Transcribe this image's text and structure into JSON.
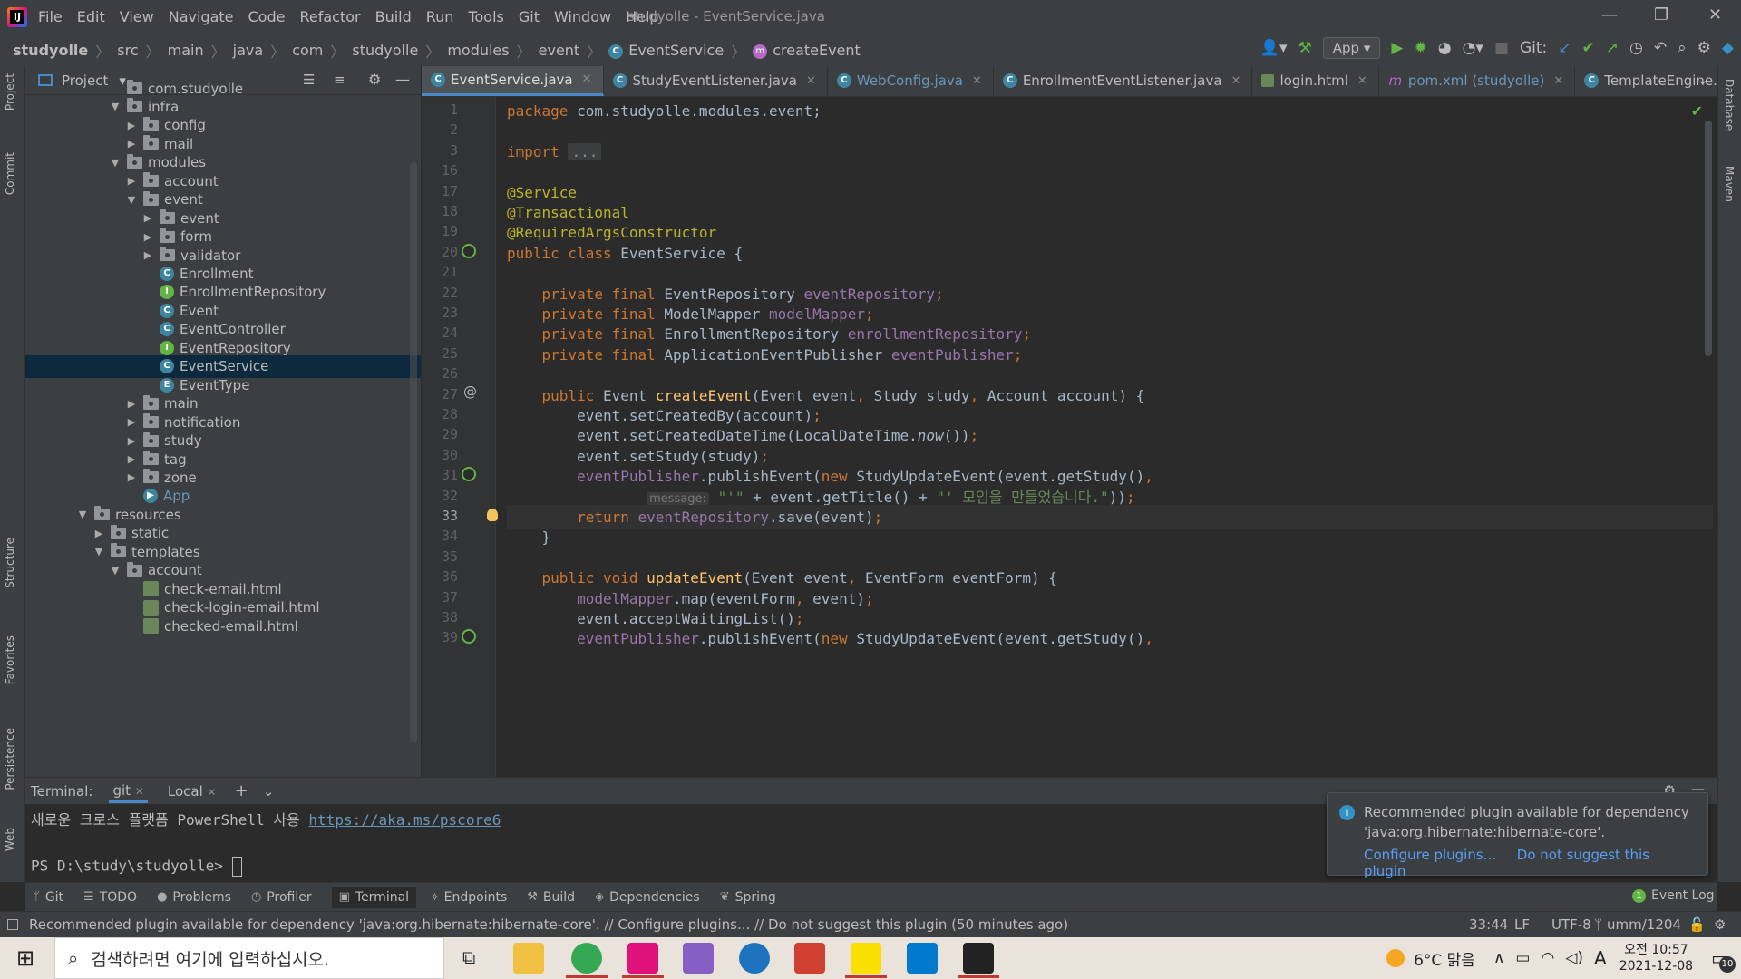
{
  "window": {
    "title": "studyolle - EventService.java"
  },
  "menu": [
    "File",
    "Edit",
    "View",
    "Navigate",
    "Code",
    "Refactor",
    "Build",
    "Run",
    "Tools",
    "Git",
    "Window",
    "Help"
  ],
  "breadcrumb": [
    "studyolle",
    "src",
    "main",
    "java",
    "com",
    "studyolle",
    "modules",
    "event",
    "EventService",
    "createEvent"
  ],
  "toolbar": {
    "run_config": "App",
    "git_label": "Git:"
  },
  "project": {
    "title": "Project",
    "tree": [
      {
        "label": "com.studyolle",
        "indent": 5,
        "arrow": "",
        "icon": "folder"
      },
      {
        "label": "infra",
        "indent": 5,
        "arrow": "open",
        "icon": "folder"
      },
      {
        "label": "config",
        "indent": 6,
        "arrow": "closed",
        "icon": "folder"
      },
      {
        "label": "mail",
        "indent": 6,
        "arrow": "closed",
        "icon": "folder"
      },
      {
        "label": "modules",
        "indent": 5,
        "arrow": "open",
        "icon": "folder"
      },
      {
        "label": "account",
        "indent": 6,
        "arrow": "closed",
        "icon": "folder"
      },
      {
        "label": "event",
        "indent": 6,
        "arrow": "open",
        "icon": "folder"
      },
      {
        "label": "event",
        "indent": 7,
        "arrow": "closed",
        "icon": "folder"
      },
      {
        "label": "form",
        "indent": 7,
        "arrow": "closed",
        "icon": "folder"
      },
      {
        "label": "validator",
        "indent": 7,
        "arrow": "closed",
        "icon": "folder"
      },
      {
        "label": "Enrollment",
        "indent": 7,
        "arrow": "",
        "icon": "class"
      },
      {
        "label": "EnrollmentRepository",
        "indent": 7,
        "arrow": "",
        "icon": "interface"
      },
      {
        "label": "Event",
        "indent": 7,
        "arrow": "",
        "icon": "class"
      },
      {
        "label": "EventController",
        "indent": 7,
        "arrow": "",
        "icon": "class"
      },
      {
        "label": "EventRepository",
        "indent": 7,
        "arrow": "",
        "icon": "interface"
      },
      {
        "label": "EventService",
        "indent": 7,
        "arrow": "",
        "icon": "class",
        "selected": true
      },
      {
        "label": "EventType",
        "indent": 7,
        "arrow": "",
        "icon": "enum"
      },
      {
        "label": "main",
        "indent": 6,
        "arrow": "closed",
        "icon": "folder"
      },
      {
        "label": "notification",
        "indent": 6,
        "arrow": "closed",
        "icon": "folder"
      },
      {
        "label": "study",
        "indent": 6,
        "arrow": "closed",
        "icon": "folder"
      },
      {
        "label": "tag",
        "indent": 6,
        "arrow": "closed",
        "icon": "folder"
      },
      {
        "label": "zone",
        "indent": 6,
        "arrow": "closed",
        "icon": "folder"
      },
      {
        "label": "App",
        "indent": 6,
        "arrow": "",
        "icon": "app"
      },
      {
        "label": "resources",
        "indent": 3,
        "arrow": "open",
        "icon": "folder"
      },
      {
        "label": "static",
        "indent": 4,
        "arrow": "closed",
        "icon": "folder"
      },
      {
        "label": "templates",
        "indent": 4,
        "arrow": "open",
        "icon": "folder"
      },
      {
        "label": "account",
        "indent": 5,
        "arrow": "open",
        "icon": "folder"
      },
      {
        "label": "check-email.html",
        "indent": 6,
        "arrow": "",
        "icon": "html"
      },
      {
        "label": "check-login-email.html",
        "indent": 6,
        "arrow": "",
        "icon": "html"
      },
      {
        "label": "checked-email.html",
        "indent": 6,
        "arrow": "",
        "icon": "html"
      }
    ]
  },
  "tabs": [
    {
      "label": "EventService.java",
      "badge": "C",
      "active": true
    },
    {
      "label": "StudyEventListener.java",
      "badge": "C"
    },
    {
      "label": "WebConfig.java",
      "badge": "C",
      "link": true
    },
    {
      "label": "EnrollmentEventListener.java",
      "badge": "C"
    },
    {
      "label": "login.html",
      "badge": "H"
    },
    {
      "label": "pom.xml (studyolle)",
      "badge": "m",
      "link": true
    },
    {
      "label": "TemplateEngine.class",
      "badge": "C"
    }
  ],
  "code": [
    {
      "n": "1",
      "html": "<span class='kw'>package</span> com.studyolle.modules.event;"
    },
    {
      "n": "2",
      "html": ""
    },
    {
      "n": "3",
      "html": "<span class='kw'>import</span> <span class='fold'>...</span>"
    },
    {
      "n": "16",
      "html": ""
    },
    {
      "n": "17",
      "html": "<span class='an'>@Service</span>"
    },
    {
      "n": "18",
      "html": "<span class='an'>@Transactional</span>"
    },
    {
      "n": "19",
      "html": "<span class='an'>@RequiredArgsConstructor</span>"
    },
    {
      "n": "20",
      "html": "<span class='kw'>public class</span> EventService {"
    },
    {
      "n": "21",
      "html": ""
    },
    {
      "n": "22",
      "html": "    <span class='kw'>private final</span> EventRepository <span class='fld'>eventRepository</span><span class='kw'>;</span>"
    },
    {
      "n": "23",
      "html": "    <span class='kw'>private final</span> ModelMapper <span class='fld'>modelMapper</span><span class='kw'>;</span>"
    },
    {
      "n": "24",
      "html": "    <span class='kw'>private final</span> EnrollmentRepository <span class='fld'>enrollmentRepository</span><span class='kw'>;</span>"
    },
    {
      "n": "25",
      "html": "    <span class='kw'>private final</span> ApplicationEventPublisher <span class='fld'>eventPublisher</span><span class='kw'>;</span>"
    },
    {
      "n": "26",
      "html": ""
    },
    {
      "n": "27",
      "html": "    <span class='kw'>public</span> Event <span class='fn'>createEvent</span>(Event event<span class='kw'>,</span> Study study<span class='kw'>,</span> Account account) {"
    },
    {
      "n": "28",
      "html": "        event.setCreatedBy(account)<span class='kw'>;</span>"
    },
    {
      "n": "29",
      "html": "        event.setCreatedDateTime(LocalDateTime.<span class='it'>now</span>())<span class='kw'>;</span>"
    },
    {
      "n": "30",
      "html": "        event.setStudy(study)<span class='kw'>;</span>"
    },
    {
      "n": "31",
      "html": "        <span class='fld'>eventPublisher</span>.publishEvent(<span class='kw'>new</span> StudyUpdateEvent(event.getStudy()<span class='kw'>,</span>"
    },
    {
      "n": "32",
      "html": "                <span class='hint'>message:</span> <span class='str'>\"'\"</span> + event.getTitle() + <span class='str'>\"' 모임을 만들었습니다.\"</span>))<span class='kw'>;</span>"
    },
    {
      "n": "33",
      "html": "        <span class='kw'>return</span> <span class='fld'>eventRepository</span>.save(event)<span class='kw'>;</span>",
      "current": true
    },
    {
      "n": "34",
      "html": "    }"
    },
    {
      "n": "35",
      "html": ""
    },
    {
      "n": "36",
      "html": "    <span class='kw'>public void</span> <span class='fn'>updateEvent</span>(Event event<span class='kw'>,</span> EventForm eventForm) {"
    },
    {
      "n": "37",
      "html": "        <span class='fld'>modelMapper</span>.map(eventForm<span class='kw'>,</span> event)<span class='kw'>;</span>"
    },
    {
      "n": "38",
      "html": "        event.acceptWaitingList()<span class='kw'>;</span>"
    },
    {
      "n": "39",
      "html": "        <span class='fld'>eventPublisher</span>.publishEvent(<span class='kw'>new</span> StudyUpdateEvent(event.getStudy()<span class='kw'>,</span>"
    }
  ],
  "terminal": {
    "label": "Terminal:",
    "tabs": [
      "git",
      "Local"
    ],
    "line1_text": "새로운 크로스 플랫폼 PowerShell 사용 ",
    "line1_link": "https://aka.ms/pscore6",
    "prompt": "PS D:\\study\\studyolle> "
  },
  "notification": {
    "title": "Recommended plugin available for dependency 'java:org.hibernate:hibernate-core'.",
    "action1": "Configure plugins...",
    "action2": "Do not suggest this plugin"
  },
  "toolwindows": [
    "Git",
    "TODO",
    "Problems",
    "Profiler",
    "Terminal",
    "Endpoints",
    "Build",
    "Dependencies",
    "Spring"
  ],
  "event_log": {
    "label": "Event Log",
    "count": "1"
  },
  "status": {
    "message": "Recommended plugin available for dependency 'java:org.hibernate:hibernate-core'. // Configure plugins... // Do not suggest this plugin (50 minutes ago)",
    "position": "33:44",
    "line_sep": "LF",
    "encoding": "UTF-8",
    "branch": "umm/1204"
  },
  "side_tabs": {
    "left": [
      "Project",
      "Commit",
      "Structure",
      "Favorites",
      "Persistence",
      "Web"
    ],
    "right": [
      "Database",
      "Maven"
    ]
  },
  "taskbar": {
    "search_placeholder": "검색하려면 여기에 입력하십시오.",
    "weather": "6°C  맑음",
    "ampm": "오전 10:57",
    "date": "2021-12-08",
    "ime": "A",
    "notif_count": "10"
  }
}
